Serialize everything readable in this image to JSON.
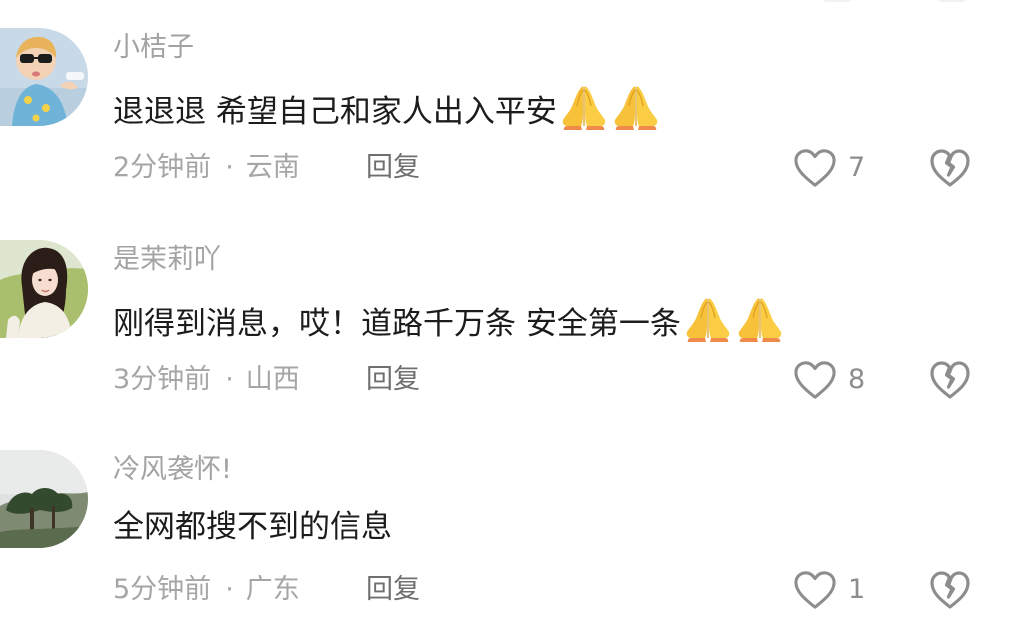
{
  "comments": [
    {
      "username": "小桔子",
      "content": "退退退 希望自己和家人出入平安",
      "emoji": [
        "🙏",
        "🙏"
      ],
      "time": "2分钟前",
      "location": "云南",
      "separator": "·",
      "reply_label": "回复",
      "likes": "7"
    },
    {
      "username": "是茉莉吖",
      "content": "刚得到消息，哎！道路千万条 安全第一条",
      "emoji": [
        "🙏",
        "🙏"
      ],
      "time": "3分钟前",
      "location": "山西",
      "separator": "·",
      "reply_label": "回复",
      "likes": "8"
    },
    {
      "username": "冷风袭怀!",
      "content": "全网都搜不到的信息",
      "emoji": [],
      "time": "5分钟前",
      "location": "广东",
      "separator": "·",
      "reply_label": "回复",
      "likes": "1"
    }
  ],
  "icons": {
    "like": "heart-outline-icon",
    "dislike": "broken-heart-icon",
    "emoji": "folded-hands-emoji"
  },
  "colors": {
    "background": "#ffffff",
    "username": "#a3a3a3",
    "content": "#1c1c1c",
    "meta": "#a6a6a6",
    "reply": "#6f6f6f",
    "icon": "#8d8d8d"
  }
}
